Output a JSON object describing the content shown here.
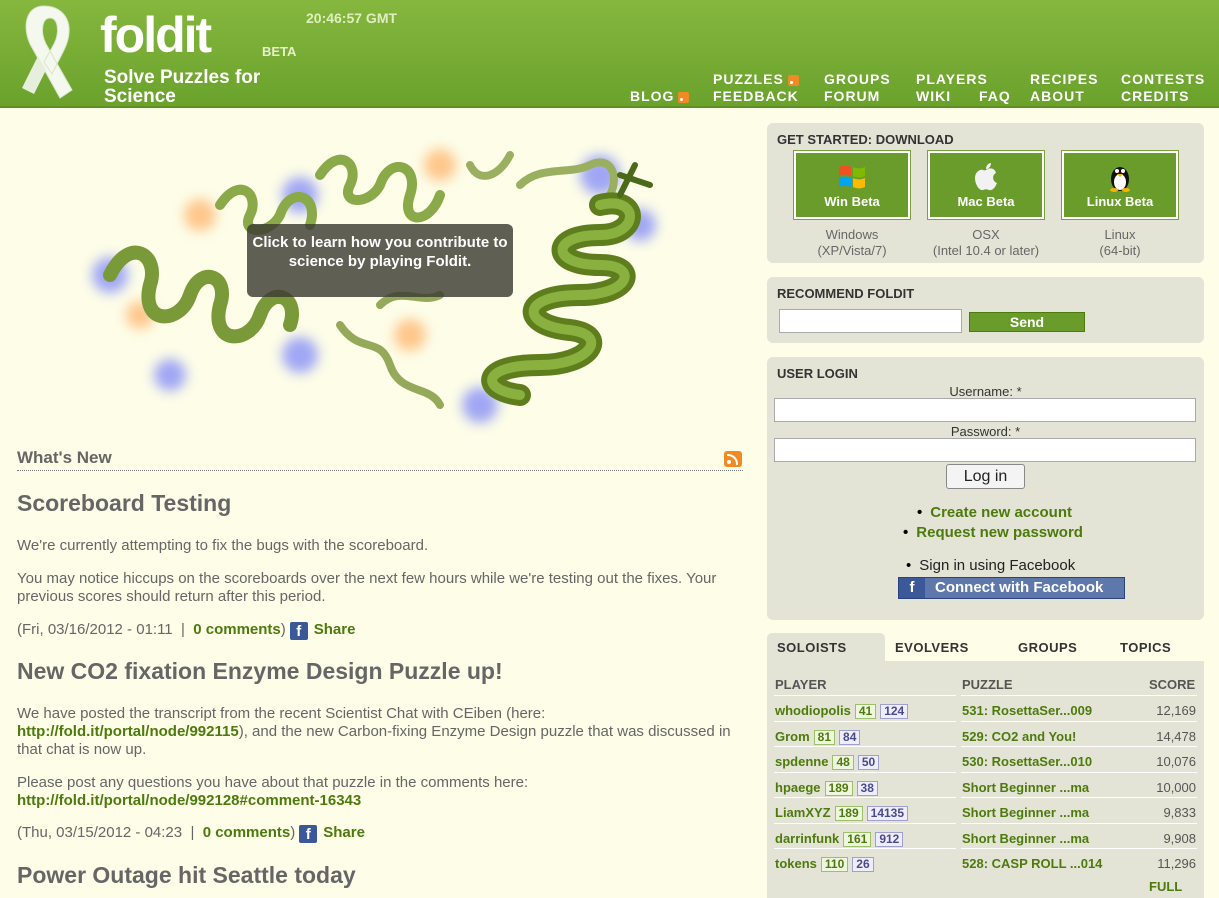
{
  "header": {
    "logo": "foldit",
    "beta": "BETA",
    "tagline": "Solve Puzzles for Science",
    "clock": "20:46:57 GMT",
    "nav": {
      "blog": "BLOG",
      "puzzles": "PUZZLES",
      "feedback": "FEEDBACK",
      "groups": "GROUPS",
      "forum": "FORUM",
      "players": "PLAYERS",
      "wiki": "WIKI",
      "faq": "FAQ",
      "recipes": "RECIPES",
      "about": "ABOUT",
      "contests": "CONTESTS",
      "credits": "CREDITS"
    }
  },
  "hero": {
    "caption": "Click to learn how you contribute to science by playing Foldit."
  },
  "news": {
    "heading": "What's New",
    "posts": [
      {
        "title": "Scoreboard Testing",
        "p1": "We're currently attempting to fix the bugs with the scoreboard.",
        "p2": "You may notice hiccups on the scoreboards over the next few hours while we're testing out the fixes. Your previous scores should return after this period.",
        "date": "(Fri, 03/16/2012 - 01:11  |  ",
        "comments": "0 comments",
        "close": ")",
        "share": "Share"
      },
      {
        "title": "New CO2 fixation Enzyme Design Puzzle up!",
        "p1a": "We have posted the transcript from the recent Scientist Chat with CEiben (here: ",
        "p1link": "http://fold.it/portal/node/992115",
        "p1b": "), and the new Carbon-fixing Enzyme Design puzzle that was discussed in that chat is now up.",
        "p2a": "Please post any questions you have about that puzzle in the comments here: ",
        "p2link": "http://fold.it/portal/node/992128#comment-16343",
        "date": "(Thu, 03/15/2012 - 04:23  |  ",
        "comments": "0 comments",
        "close": ")",
        "share": "Share"
      },
      {
        "title": "Power Outage hit Seattle today"
      }
    ]
  },
  "download": {
    "heading": "GET STARTED: DOWNLOAD",
    "items": [
      {
        "label": "Win Beta",
        "os": "Windows",
        "detail": "(XP/Vista/7)"
      },
      {
        "label": "Mac Beta",
        "os": "OSX",
        "detail": "(Intel 10.4 or later)"
      },
      {
        "label": "Linux Beta",
        "os": "Linux",
        "detail": "(64-bit)"
      }
    ]
  },
  "recommend": {
    "heading": "RECOMMEND FOLDIT",
    "input": "",
    "send": "Send"
  },
  "login": {
    "heading": "USER LOGIN",
    "username_label": "Username: *",
    "password_label": "Password: *",
    "button": "Log in",
    "create": "Create new account",
    "request": "Request new password",
    "facebook_signin": "Sign in using Facebook",
    "facebook_connect": "Connect with Facebook"
  },
  "scoreboard": {
    "tabs": [
      "SOLOISTS",
      "EVOLVERS",
      "GROUPS",
      "TOPICS"
    ],
    "headers": {
      "player": "PLAYER",
      "puzzle": "PUZZLE",
      "score": "SCORE"
    },
    "rows": [
      {
        "player": "whodiopolis",
        "r1": "41",
        "r2": "124",
        "puzzle": "531: RosettaSer...009",
        "score": "12,169"
      },
      {
        "player": "Grom",
        "r1": "81",
        "r2": "84",
        "puzzle": "529: CO2 and You!",
        "score": "14,478"
      },
      {
        "player": "spdenne",
        "r1": "48",
        "r2": "50",
        "puzzle": "530: RosettaSer...010",
        "score": "10,076"
      },
      {
        "player": "hpaege",
        "r1": "189",
        "r2": "38",
        "puzzle": "Short Beginner ...ma",
        "score": "10,000"
      },
      {
        "player": "LiamXYZ",
        "r1": "189",
        "r2": "14135",
        "puzzle": "Short Beginner ...ma",
        "score": "9,833"
      },
      {
        "player": "darrinfunk",
        "r1": "161",
        "r2": "912",
        "puzzle": "Short Beginner ...ma",
        "score": "9,908"
      },
      {
        "player": "tokens",
        "r1": "110",
        "r2": "26",
        "puzzle": "528: CASP ROLL ...014",
        "score": "11,296"
      }
    ],
    "full": "FULL"
  }
}
